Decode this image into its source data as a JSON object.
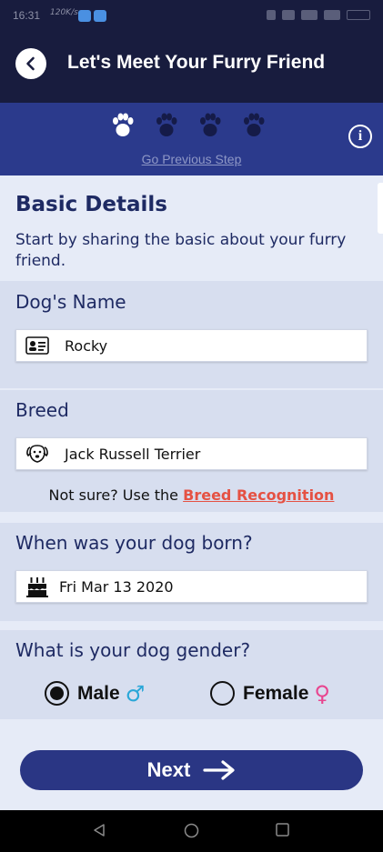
{
  "status_bar": {
    "time": "16:31",
    "speed": "120K/s"
  },
  "header": {
    "title": "Let's Meet Your Furry Friend",
    "back_icon": "chevron-left-icon"
  },
  "steps": {
    "total": 4,
    "current": 1,
    "prev_link": "Go Previous Step",
    "info_icon": "info-icon"
  },
  "basic": {
    "title": "Basic Details",
    "description": "Start by sharing the basic about your furry friend."
  },
  "name_field": {
    "label": "Dog's Name",
    "value": "Rocky",
    "icon": "id-card-icon"
  },
  "breed_field": {
    "label": "Breed",
    "value": "Jack Russell Terrier",
    "icon": "dog-face-icon",
    "hint": "Not sure? Use the",
    "hint_link": "Breed Recognition"
  },
  "birth_field": {
    "label": "When was your dog born?",
    "value": "Fri Mar 13 2020",
    "icon": "birthday-cake-icon"
  },
  "gender_field": {
    "label": "What is your dog gender?",
    "options": [
      {
        "label": "Male",
        "symbol": "♂",
        "selected": true
      },
      {
        "label": "Female",
        "symbol": "♀",
        "selected": false
      }
    ]
  },
  "next_button": {
    "label": "Next"
  },
  "colors": {
    "header_bg": "#181c3e",
    "step_bar_bg": "#2b3a8c",
    "accent_red": "#e55143",
    "male_color": "#2aa7d8",
    "female_color": "#e8458f",
    "button_bg": "#2a3684"
  }
}
